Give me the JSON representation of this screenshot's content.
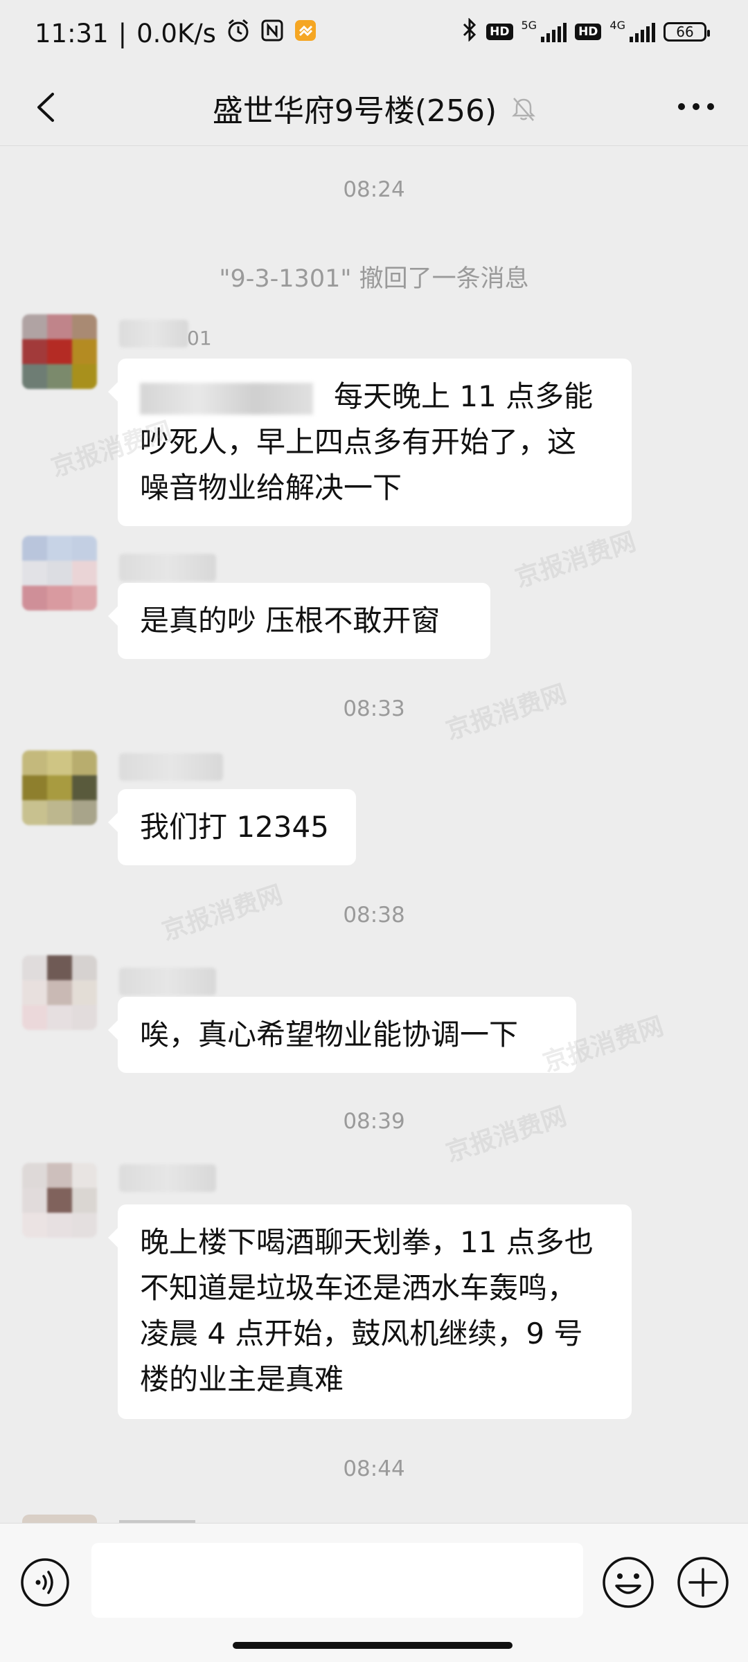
{
  "status_bar": {
    "time": "11:31",
    "speed": "0.0K/s",
    "hd1": "HD",
    "net1": "5G",
    "hd2": "HD",
    "net2": "4G",
    "battery": "66"
  },
  "header": {
    "title": "盛世华府9号楼(256)"
  },
  "messages": [
    {
      "type": "time",
      "text": "08:24"
    },
    {
      "type": "system",
      "text": "\"9-3-1301\" 撤回了一条消息"
    },
    {
      "type": "msg",
      "name_tail": "01",
      "text_lines": [
        "每天晚上 11 点多能",
        "吵死人，早上四点多有开始了，这",
        "噪音物业给解决一下"
      ]
    },
    {
      "type": "msg",
      "text": "是真的吵 压根不敢开窗"
    },
    {
      "type": "time",
      "text": "08:33"
    },
    {
      "type": "msg",
      "text": "我们打 12345"
    },
    {
      "type": "time",
      "text": "08:38"
    },
    {
      "type": "msg",
      "text": "唉，真心希望物业能协调一下"
    },
    {
      "type": "time",
      "text": "08:39"
    },
    {
      "type": "msg",
      "text_lines": [
        "晚上楼下喝酒聊天划拳，11 点多也",
        "不知道是垃圾车还是洒水车轰鸣，",
        "凌晨 4 点开始，鼓风机继续，9 号",
        "楼的业主是真难"
      ]
    },
    {
      "type": "time",
      "text": "08:44"
    }
  ],
  "input": {
    "value": ""
  },
  "watermark": "京报消费网",
  "icons": [
    "back-icon",
    "mute-bell-icon",
    "more-icon",
    "voice-icon",
    "emoji-icon",
    "plus-icon",
    "alarm-icon",
    "nfc-icon",
    "bluetooth-icon",
    "signal-icon",
    "battery-icon"
  ]
}
